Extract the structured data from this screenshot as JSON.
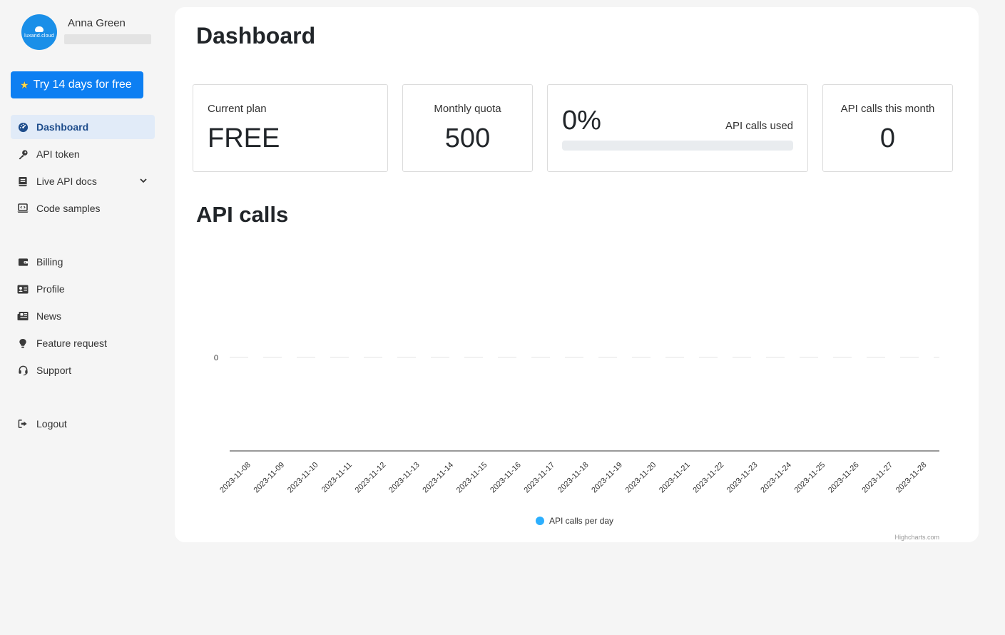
{
  "user": {
    "name": "Anna Green",
    "avatar_brand": "luxand.cloud"
  },
  "trial_button": {
    "label": "Try 14 days for free"
  },
  "nav": {
    "dashboard": "Dashboard",
    "api_token": "API token",
    "live_api_docs": "Live API docs",
    "code_samples": "Code samples",
    "billing": "Billing",
    "profile": "Profile",
    "news": "News",
    "feature_request": "Feature request",
    "support": "Support",
    "logout": "Logout"
  },
  "page": {
    "title": "Dashboard"
  },
  "stats": {
    "current_plan": {
      "label": "Current plan",
      "value": "FREE"
    },
    "monthly_quota": {
      "label": "Monthly quota",
      "value": "500"
    },
    "usage": {
      "percent_text": "0%",
      "label": "API calls used",
      "percent": 0
    },
    "calls_month": {
      "label": "API calls this month",
      "value": "0"
    }
  },
  "chart_section": {
    "title": "API calls"
  },
  "colors": {
    "accent": "#0d7ff2",
    "series": "#2caffe"
  },
  "chart_data": {
    "type": "line",
    "categories": [
      "2023-11-08",
      "2023-11-09",
      "2023-11-10",
      "2023-11-11",
      "2023-11-12",
      "2023-11-13",
      "2023-11-14",
      "2023-11-15",
      "2023-11-16",
      "2023-11-17",
      "2023-11-18",
      "2023-11-19",
      "2023-11-20",
      "2023-11-21",
      "2023-11-22",
      "2023-11-23",
      "2023-11-24",
      "2023-11-25",
      "2023-11-26",
      "2023-11-27",
      "2023-11-28"
    ],
    "series": [
      {
        "name": "API calls per day",
        "values": [
          0,
          0,
          0,
          0,
          0,
          0,
          0,
          0,
          0,
          0,
          0,
          0,
          0,
          0,
          0,
          0,
          0,
          0,
          0,
          0,
          0
        ]
      }
    ],
    "yticks": [
      0
    ],
    "legend": "bottom",
    "credits": "Highcharts.com"
  }
}
